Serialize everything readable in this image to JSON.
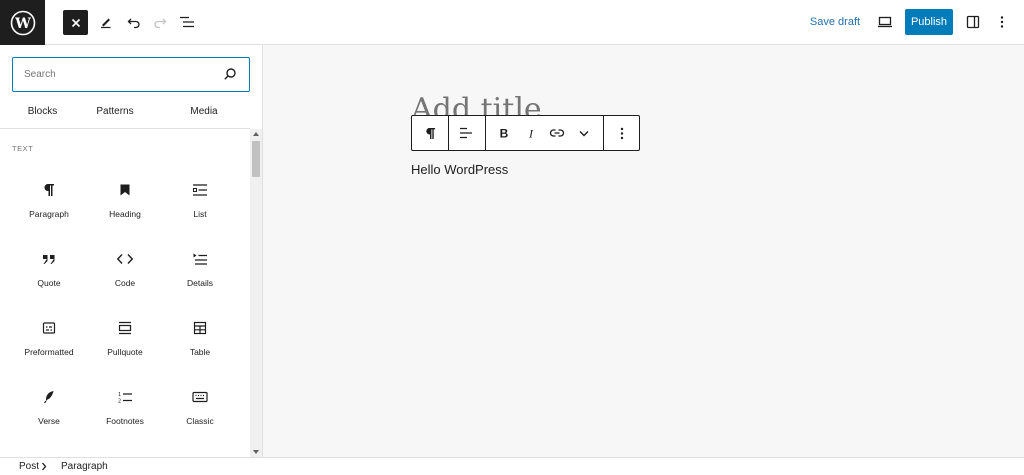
{
  "header": {
    "save_draft_label": "Save draft",
    "publish_label": "Publish"
  },
  "inserter": {
    "search_placeholder": "Search",
    "tabs": [
      {
        "label": "Blocks",
        "active": true
      },
      {
        "label": "Patterns",
        "active": false
      },
      {
        "label": "Media",
        "active": false
      }
    ],
    "section_label": "TEXT",
    "blocks": [
      {
        "label": "Paragraph",
        "icon": "paragraph-icon"
      },
      {
        "label": "Heading",
        "icon": "heading-icon"
      },
      {
        "label": "List",
        "icon": "list-icon"
      },
      {
        "label": "Quote",
        "icon": "quote-icon"
      },
      {
        "label": "Code",
        "icon": "code-icon"
      },
      {
        "label": "Details",
        "icon": "details-icon"
      },
      {
        "label": "Preformatted",
        "icon": "preformatted-icon"
      },
      {
        "label": "Pullquote",
        "icon": "pullquote-icon"
      },
      {
        "label": "Table",
        "icon": "table-icon"
      },
      {
        "label": "Verse",
        "icon": "verse-icon"
      },
      {
        "label": "Footnotes",
        "icon": "footnotes-icon"
      },
      {
        "label": "Classic",
        "icon": "classic-icon"
      }
    ]
  },
  "editor": {
    "title_placeholder": "Add title",
    "paragraph_text": "Hello WordPress"
  },
  "breadcrumb": {
    "items": [
      "Post",
      "Paragraph"
    ]
  },
  "colors": {
    "accent": "#007cba",
    "link": "#2271b1",
    "dark": "#1e1e1e",
    "canvas_bg": "#f7f7f7"
  }
}
